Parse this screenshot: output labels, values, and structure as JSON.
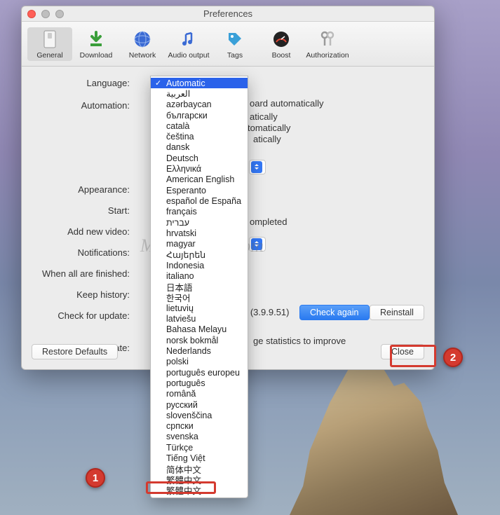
{
  "window": {
    "title": "Preferences"
  },
  "toolbar": {
    "items": [
      {
        "key": "general",
        "label": "General"
      },
      {
        "key": "download",
        "label": "Download"
      },
      {
        "key": "network",
        "label": "Network"
      },
      {
        "key": "audio",
        "label": "Audio output"
      },
      {
        "key": "tags",
        "label": "Tags"
      },
      {
        "key": "boost",
        "label": "Boost"
      },
      {
        "key": "auth",
        "label": "Authorization"
      }
    ]
  },
  "labels": {
    "language": "Language:",
    "automation": "Automation:",
    "appearance": "Appearance:",
    "start": "Start:",
    "addnew": "Add new video:",
    "notifications": "Notifications:",
    "whenfinished": "When all are finished:",
    "keephistory": "Keep history:",
    "checkupdate": "Check for update:",
    "update": "Update:"
  },
  "fragments": {
    "auto1": "oard automatically",
    "auto2": "atically",
    "auto3": "tomatically",
    "auto4": "atically",
    "notif": "ompleted",
    "upd_version": "n (3.9.9.51)",
    "stats": "ge statistics to improve"
  },
  "buttons": {
    "check_again": "Check again",
    "reinstall": "Reinstall",
    "restore": "Restore Defaults",
    "close": "Close"
  },
  "dropdown": {
    "selected": "Automatic",
    "items": [
      "Automatic",
      "العربية",
      "azərbaycan",
      "български",
      "català",
      "čeština",
      "dansk",
      "Deutsch",
      "Ελληνικά",
      "American English",
      "Esperanto",
      "español de España",
      "français",
      "עברית",
      "hrvatski",
      "magyar",
      "Հայերեն",
      "Indonesia",
      "italiano",
      "日本語",
      "한국어",
      "lietuvių",
      "latviešu",
      "Bahasa Melayu",
      "norsk bokmål",
      "Nederlands",
      "polski",
      "português europeu",
      "português",
      "română",
      "русский",
      "slovenščina",
      "српски",
      "svenska",
      "Türkçe",
      "Tiếng Việt",
      "简体中文",
      "繁體中文",
      "繁體中文"
    ]
  },
  "watermark": "Mac.Macxz.Com",
  "callouts": {
    "one": "1",
    "two": "2"
  },
  "highlight_item": "简体中文"
}
